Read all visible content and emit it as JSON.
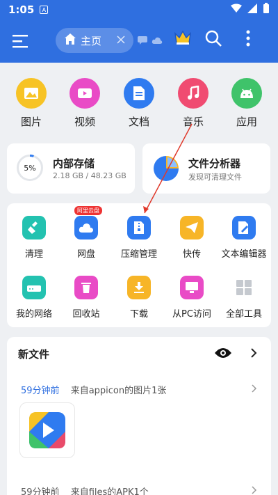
{
  "status": {
    "time": "1:05"
  },
  "header": {
    "tab_label": "主页"
  },
  "categories": [
    {
      "label": "图片",
      "icon": "image-icon",
      "color": "#f7c325"
    },
    {
      "label": "视频",
      "icon": "video-icon",
      "color": "#e94bc6"
    },
    {
      "label": "文档",
      "icon": "document-icon",
      "color": "#2f7bf0"
    },
    {
      "label": "音乐",
      "icon": "music-icon",
      "color": "#f04b71"
    },
    {
      "label": "应用",
      "icon": "android-icon",
      "color": "#3fc36a"
    }
  ],
  "storage": {
    "percent": "5%",
    "title": "内部存储",
    "detail": "2.18 GB / 48.23 GB"
  },
  "analyzer": {
    "title": "文件分析器",
    "subtitle": "发现可清理文件"
  },
  "tools": [
    {
      "label": "清理",
      "icon": "broom-icon",
      "color": "#23c2b0"
    },
    {
      "label": "网盘",
      "icon": "cloud-icon",
      "color": "#2f7bf0",
      "badge": "阿里云盘"
    },
    {
      "label": "压缩管理",
      "icon": "zip-icon",
      "color": "#2f7bf0"
    },
    {
      "label": "快传",
      "icon": "send-icon",
      "color": "#f7b527"
    },
    {
      "label": "文本编辑器",
      "icon": "edit-icon",
      "color": "#2f7bf0"
    },
    {
      "label": "我的网络",
      "icon": "router-icon",
      "color": "#23c2b0"
    },
    {
      "label": "回收站",
      "icon": "trash-icon",
      "color": "#e94bc6"
    },
    {
      "label": "下载",
      "icon": "download-icon",
      "color": "#f7b527"
    },
    {
      "label": "从PC访问",
      "icon": "pc-icon",
      "color": "#e94bc6"
    },
    {
      "label": "全部工具",
      "icon": "grid-icon",
      "color": "#c5c9cf"
    }
  ],
  "new_files": {
    "title": "新文件",
    "items": [
      {
        "time": "59分钟前",
        "desc": "来自appicon的图片1张"
      },
      {
        "time": "59分钟前",
        "desc": "来自files的APK1个"
      }
    ]
  }
}
